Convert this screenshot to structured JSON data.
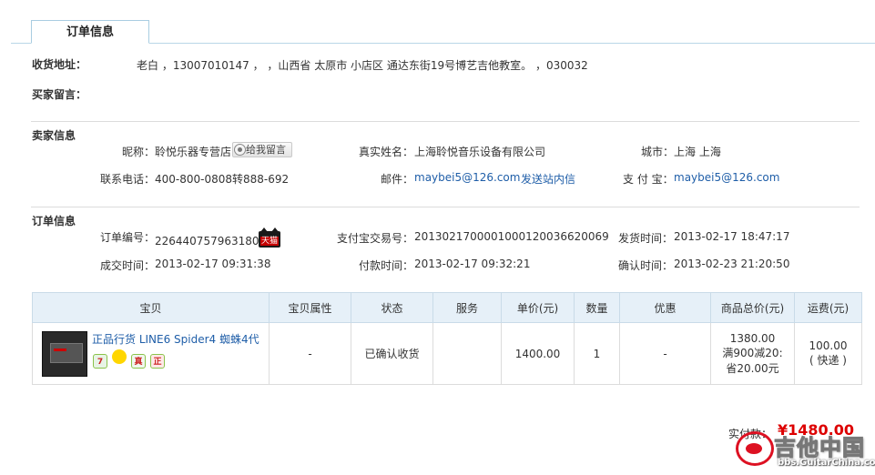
{
  "tab": {
    "label": "订单信息"
  },
  "shipping": {
    "address_label": "收货地址：",
    "address_value": "老白 ，13007010147 ， ，山西省 太原市 小店区 通达东街19号博艺吉他教室。 ，030032",
    "buyer_msg_label": "买家留言："
  },
  "seller": {
    "section_title": "卖家信息",
    "nick_label": "昵称：",
    "nick_value": "聆悦乐器专营店",
    "msg_button": "给我留言",
    "realname_label": "真实姓名：",
    "realname_value": "上海聆悦音乐设备有限公司",
    "city_label": "城市：",
    "city_value": "上海 上海",
    "phone_label": "联系电话：",
    "phone_value": "400-800-0808转888-692",
    "mail_label": "邮件：",
    "mail_value": "maybei5@126.com",
    "send_msg_link": "发送站内信",
    "alipay_label": "支 付 宝：",
    "alipay_value": "maybei5@126.com"
  },
  "order": {
    "section_title": "订单信息",
    "order_no_label": "订单编号：",
    "order_no_value": "226440757963180",
    "tmall_badge": "天猫",
    "alipay_no_label": "支付宝交易号：",
    "alipay_no_value": "2013021700001000120036620069",
    "ship_time_label": "发货时间：",
    "ship_time_value": "2013-02-17 18:47:17",
    "deal_time_label": "成交时间：",
    "deal_time_value": "2013-02-17 09:31:38",
    "pay_time_label": "付款时间：",
    "pay_time_value": "2013-02-17 09:32:21",
    "confirm_time_label": "确认时间：",
    "confirm_time_value": "2013-02-23 21:20:50"
  },
  "table": {
    "headers": [
      "宝贝",
      "宝贝属性",
      "状态",
      "服务",
      "单价(元)",
      "数量",
      "优惠",
      "商品总价(元)",
      "运费(元)"
    ],
    "row": {
      "title": "正品行货 LINE6 Spider4 蜘蛛4代",
      "badge_icons": [
        "seven-day-return-icon",
        "gold-coin-icon",
        "genuine-icon",
        "authentic-icon"
      ],
      "badge_glyphs": [
        "7",
        "",
        "真",
        "正"
      ],
      "attr": "-",
      "status": "已确认收货",
      "service": "",
      "unit_price": "1400.00",
      "quantity": "1",
      "discount": "-",
      "total_line1": "1380.00",
      "total_line2": "满900减20:",
      "total_line3": "省20.00元",
      "shipping_line1": "100.00",
      "shipping_line2": "( 快递 )"
    }
  },
  "summary": {
    "paid_label": "实付款：",
    "paid_value": "¥1480.00"
  },
  "watermark": {
    "cn": "吉他中国",
    "en": "bbs.GuitarChina.com"
  },
  "colors": {
    "link": "#1f5ea8",
    "price": "#d00000",
    "header_bg": "#e6f0f8"
  }
}
